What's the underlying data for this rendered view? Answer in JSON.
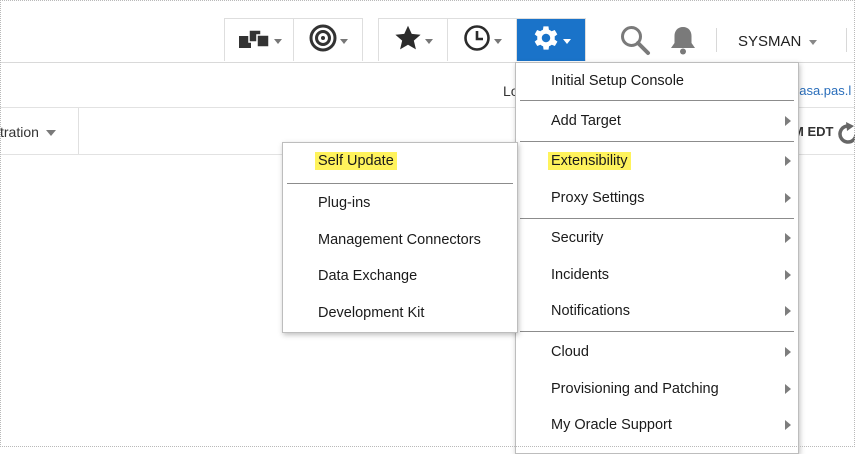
{
  "toolbar": {
    "targets_icon": "targets-icon",
    "monitoring_icon": "target-monitoring-icon",
    "favorites_icon": "star-icon",
    "history_icon": "clock-icon",
    "setup_icon": "gear-icon",
    "search_icon": "search-icon",
    "notifications_icon": "bell-icon",
    "user": "SYSMAN",
    "accent": "#1a73c9"
  },
  "info": {
    "login_fragment": "Lo",
    "host_fragment": "pasa.pas.l"
  },
  "tabs": {
    "label_fragment": "tration",
    "time_fragment": "M EDT"
  },
  "setup_menu": {
    "items": [
      {
        "label": "Initial Setup Console",
        "submenu": false
      },
      {
        "label": "Add Target",
        "submenu": true
      },
      {
        "label": "Extensibility",
        "submenu": true,
        "highlighted": true
      },
      {
        "label": "Proxy Settings",
        "submenu": true
      },
      {
        "label": "Security",
        "submenu": true
      },
      {
        "label": "Incidents",
        "submenu": true
      },
      {
        "label": "Notifications",
        "submenu": true
      },
      {
        "label": "Cloud",
        "submenu": true
      },
      {
        "label": "Provisioning and Patching",
        "submenu": true
      },
      {
        "label": "My Oracle Support",
        "submenu": true
      }
    ]
  },
  "extensibility_menu": {
    "items": [
      {
        "label": "Self Update",
        "highlighted": true
      },
      {
        "label": "Plug-ins"
      },
      {
        "label": "Management Connectors"
      },
      {
        "label": "Data Exchange"
      },
      {
        "label": "Development Kit"
      }
    ]
  },
  "colors": {
    "highlight": "#fff35c",
    "link": "#2a6ebb"
  }
}
